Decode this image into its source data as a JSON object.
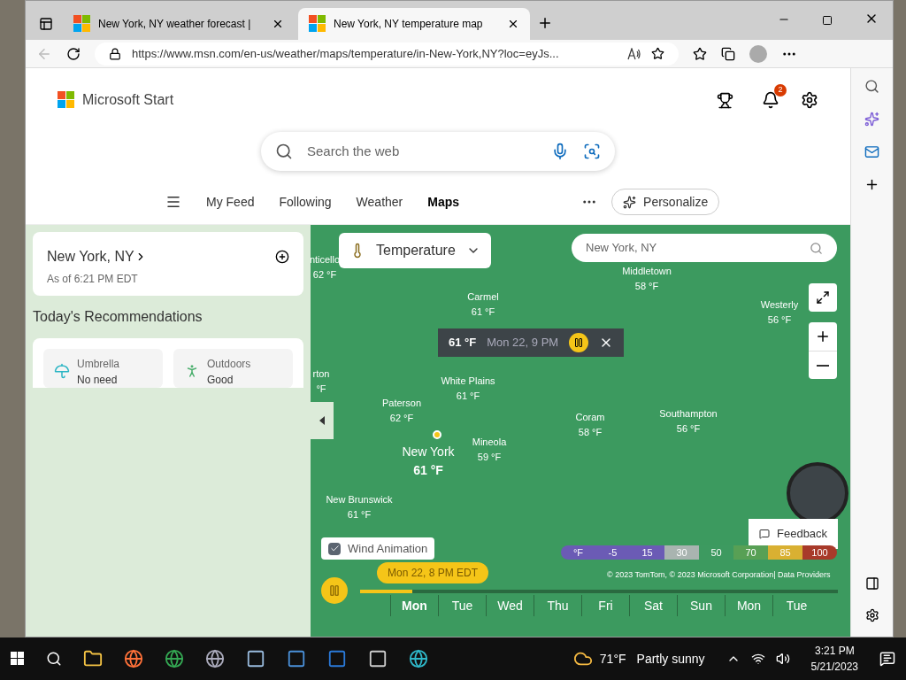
{
  "tabs": [
    {
      "title": "New York, NY weather forecast |",
      "selected": false
    },
    {
      "title": "New York, NY temperature map",
      "selected": true
    }
  ],
  "address": "https://www.msn.com/en-us/weather/maps/temperature/in-New-York,NY?loc=eyJs...",
  "brand": "Microsoft Start",
  "notification_count": "2",
  "search": {
    "placeholder": "Search the web"
  },
  "nav": [
    {
      "label": "My Feed",
      "selected": false
    },
    {
      "label": "Following",
      "selected": false
    },
    {
      "label": "Weather",
      "selected": false
    },
    {
      "label": "Maps",
      "selected": true
    }
  ],
  "personalize": "Personalize",
  "location_card": {
    "title": "New York, NY",
    "subtitle": "As of 6:21 PM EDT"
  },
  "recommendations": {
    "title": "Today's Recommendations",
    "items": [
      {
        "kind": "umbrella",
        "label": "Umbrella",
        "value": "No need"
      },
      {
        "kind": "outdoors",
        "label": "Outdoors",
        "value": "Good"
      }
    ]
  },
  "map": {
    "layer": "Temperature",
    "search_value": "New York, NY",
    "places": [
      {
        "name": "nticello",
        "temp": "62 °F",
        "major": false
      },
      {
        "name": "Carmel",
        "temp": "61 °F",
        "major": false
      },
      {
        "name": "Middletown",
        "temp": "58 °F",
        "major": false
      },
      {
        "name": "Westerly",
        "temp": "56 °F",
        "major": false
      },
      {
        "name": "rton",
        "temp": "°F",
        "major": false
      },
      {
        "name": "White Plains",
        "temp": "61 °F",
        "major": false
      },
      {
        "name": "Paterson",
        "temp": "62 °F",
        "major": false
      },
      {
        "name": "Coram",
        "temp": "58 °F",
        "major": false
      },
      {
        "name": "Southampton",
        "temp": "56 °F",
        "major": false
      },
      {
        "name": "New York",
        "temp": "61 °F",
        "major": true
      },
      {
        "name": "Mineola",
        "temp": "59 °F",
        "major": false
      },
      {
        "name": "New Brunswick",
        "temp": "61 °F",
        "major": false
      }
    ],
    "popup": {
      "temp": "61 °F",
      "time": "Mon 22, 9 PM"
    },
    "wind_animation": {
      "label": "Wind Animation",
      "checked": true
    },
    "feedback": "Feedback",
    "legend": [
      {
        "label": "°F",
        "color": "#6b5bb5"
      },
      {
        "label": "-5",
        "color": "#6b5bb5"
      },
      {
        "label": "15",
        "color": "#6b5bb5"
      },
      {
        "label": "30",
        "color": "#a9b4b0"
      },
      {
        "label": "50",
        "color": "#3d9a60"
      },
      {
        "label": "70",
        "color": "#58a055"
      },
      {
        "label": "85",
        "color": "#d9b032"
      },
      {
        "label": "100",
        "color": "#a83a2a"
      }
    ],
    "copyright": "© 2023 TomTom, © 2023 Microsoft Corporation| Data Providers",
    "timeline": {
      "current": "Mon 22, 8 PM EDT",
      "level": 0.11,
      "days": [
        {
          "label": "Mon",
          "selected": true
        },
        {
          "label": "Tue",
          "selected": false
        },
        {
          "label": "Wed",
          "selected": false
        },
        {
          "label": "Thu",
          "selected": false
        },
        {
          "label": "Fri",
          "selected": false
        },
        {
          "label": "Sat",
          "selected": false
        },
        {
          "label": "Sun",
          "selected": false
        },
        {
          "label": "Mon",
          "selected": false
        },
        {
          "label": "Tue",
          "selected": false
        }
      ]
    }
  },
  "taskbar": {
    "weather_temp": "71°F",
    "weather_text": "Partly sunny",
    "time": "3:21 PM",
    "date": "5/21/2023"
  }
}
